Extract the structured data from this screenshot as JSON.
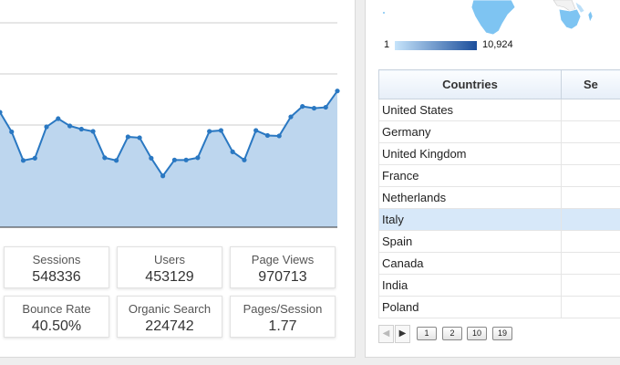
{
  "chart_data": {
    "type": "area",
    "x": [
      1,
      2,
      3,
      4,
      5,
      6,
      7,
      8,
      9,
      10,
      11,
      12,
      13,
      14,
      15,
      16,
      17,
      18,
      19,
      20,
      21,
      22,
      23,
      24,
      25,
      26,
      27,
      28,
      29,
      30
    ],
    "values": [
      18330,
      17900,
      17270,
      17320,
      18010,
      18190,
      18030,
      17960,
      17910,
      17330,
      17270,
      17790,
      17770,
      17320,
      16930,
      17280,
      17280,
      17330,
      17910,
      17930,
      17460,
      17280,
      17930,
      17820,
      17810,
      18230,
      18460,
      18420,
      18440,
      18800
    ],
    "ylim": [
      15800,
      20300
    ],
    "grid": true,
    "colors": {
      "line": "#2a78c2",
      "fill": "#bdd6ee",
      "grid": "#cccccc"
    }
  },
  "metrics": {
    "sessions": {
      "label": "Sessions",
      "value": "548336"
    },
    "users": {
      "label": "Users",
      "value": "453129"
    },
    "page_views": {
      "label": "Page Views",
      "value": "970713"
    },
    "bounce_rate": {
      "label": "Bounce Rate",
      "value": "40.50%"
    },
    "organic_search": {
      "label": "Organic Search",
      "value": "224742"
    },
    "pages_per_session": {
      "label": "Pages/Session",
      "value": "1.77"
    }
  },
  "map": {
    "legend_min": "1",
    "legend_max": "10,924",
    "colors": {
      "low": "#c6e4fb",
      "high": "#1b4e9b",
      "land": "#f2f2f2"
    }
  },
  "table": {
    "headers": {
      "country": "Countries",
      "sessions": "Se"
    },
    "rows": [
      "United States",
      "Germany",
      "United Kingdom",
      "France",
      "Netherlands",
      "Italy",
      "Spain",
      "Canada",
      "India",
      "Poland"
    ],
    "selected_row": "Italy",
    "colors": {
      "selected": "#d7e8f9",
      "header": "#e6eef8"
    }
  },
  "pager": {
    "prev_icon": "◀",
    "next_icon": "▶",
    "pages": [
      "1",
      "2",
      "10",
      "19"
    ]
  }
}
